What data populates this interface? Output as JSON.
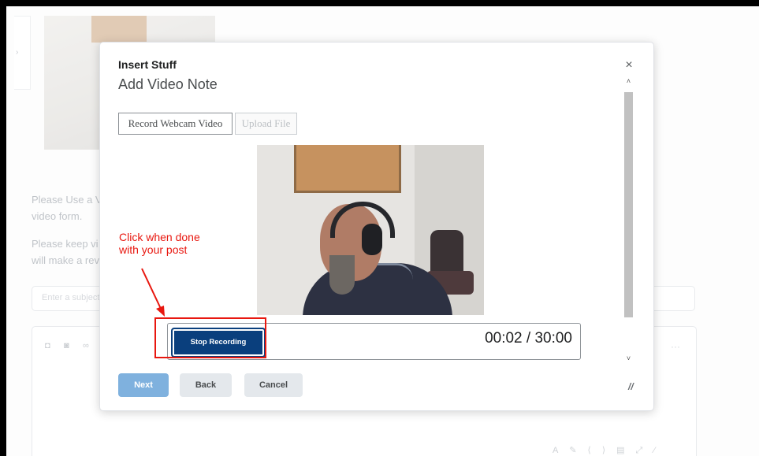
{
  "background": {
    "text_line_1": "Please Use a V",
    "text_line_2": "video form.",
    "text_line_3": "Please keep vi",
    "text_line_4": "will make a rev",
    "subject_placeholder": "Enter a subject",
    "editor_toolbar_dots": "···"
  },
  "modal": {
    "title": "Insert Stuff",
    "subtitle": "Add Video Note",
    "close_label": "×",
    "tabs": [
      {
        "label": "Record Webcam Video"
      },
      {
        "label": "Upload File"
      }
    ],
    "recorder": {
      "stop_label": "Stop Recording",
      "timer": "00:02 / 30:00"
    },
    "buttons": {
      "next": "Next",
      "back": "Back",
      "cancel": "Cancel"
    },
    "scroll_up": "˄",
    "scroll_down": "˅"
  },
  "annotation": {
    "line1": "Click when done",
    "line2": "with your post",
    "color": "#e8170f"
  },
  "colors": {
    "primary": "#0a3f7d",
    "next_disabled": "#7fb1de",
    "secondary": "#e4e8ec"
  }
}
